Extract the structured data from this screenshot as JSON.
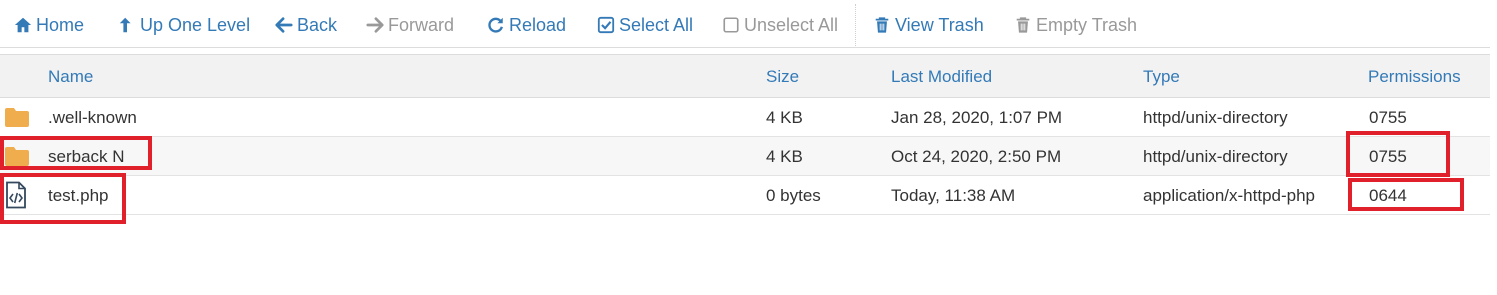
{
  "toolbar": {
    "home": "Home",
    "up_one_level": "Up One Level",
    "back": "Back",
    "forward": "Forward",
    "reload": "Reload",
    "select_all": "Select All",
    "unselect_all": "Unselect All",
    "view_trash": "View Trash",
    "empty_trash": "Empty Trash"
  },
  "table": {
    "columns": [
      "Name",
      "Size",
      "Last Modified",
      "Type",
      "Permissions"
    ],
    "rows": [
      {
        "icon": "folder-icon",
        "name": ".well-known",
        "size": "4 KB",
        "modified": "Jan 28, 2020, 1:07 PM",
        "type": "httpd/unix-directory",
        "permissions": "0755"
      },
      {
        "icon": "folder-icon",
        "name": "serback N",
        "size": "4 KB",
        "modified": "Oct 24, 2020, 2:50 PM",
        "type": "httpd/unix-directory",
        "permissions": "0755"
      },
      {
        "icon": "php-file-icon",
        "name": "test.php",
        "size": "0 bytes",
        "modified": "Today, 11:38 AM",
        "type": "application/x-httpd-php",
        "permissions": "0644"
      }
    ]
  },
  "colors": {
    "link": "#337ab7",
    "disabled": "#999999",
    "folder": "#f0ad4e",
    "highlight": "#e0202a"
  }
}
